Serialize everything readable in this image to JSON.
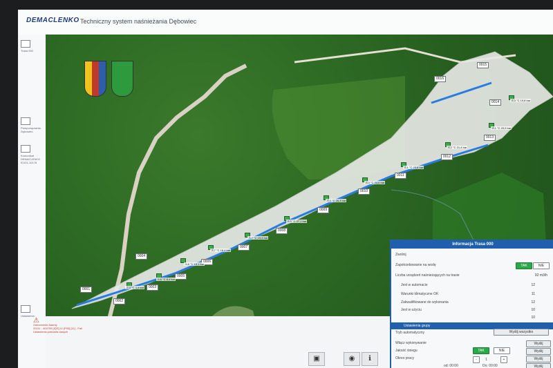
{
  "app": {
    "logo": "DEMACLENKO",
    "title": "Techniczny system  naśnieżania Dębowiec"
  },
  "sidebar": {
    "items": [
      {
        "label": "Trasa 000",
        "icon": "route-icon"
      },
      {
        "label": "Przepompownia Dębowiec",
        "icon": "pump-icon"
      },
      {
        "label": "Komunikat DEMACLENKO ID101-10178",
        "icon": "message-icon"
      },
      {
        "label": "Ustawienia",
        "icon": "wrench-icon"
      }
    ]
  },
  "alarm": {
    "title": "Ostrzeżenie Alarmy",
    "line1": "20111 - 404705 [IQS] 11 [P00] [11] - Fail",
    "line2": "Ustawienia pobrania danych"
  },
  "colors": {
    "accent": "#1f5fad",
    "green": "#2aa84a",
    "pipe": "#2a7be0"
  },
  "map": {
    "points": [
      {
        "id": "0001"
      },
      {
        "id": "0002"
      },
      {
        "id": "0003"
      },
      {
        "id": "0004"
      },
      {
        "id": "0005"
      },
      {
        "id": "0006"
      },
      {
        "id": "0007"
      },
      {
        "id": "0008"
      },
      {
        "id": "0009"
      },
      {
        "id": "0010"
      },
      {
        "id": "0011"
      },
      {
        "id": "0012"
      },
      {
        "id": "0013"
      },
      {
        "id": "0014"
      },
      {
        "id": "0015"
      },
      {
        "id": "0016"
      }
    ],
    "readings": [
      {
        "t": "-5,4 °C",
        "p": "4,9 bar"
      },
      {
        "t": "-5,6 °C",
        "p": "8,4 bar"
      },
      {
        "t": "-5,6 °C",
        "p": "15,1 bar"
      },
      {
        "t": "-5,7 °C",
        "p": "18,4 bar"
      },
      {
        "t": "-5,7 °C",
        "p": "19,4 bar"
      },
      {
        "t": "-5,9 °C",
        "p": "27,1 bar"
      },
      {
        "t": "-6,0 °C",
        "p": "26,3 bar"
      },
      {
        "t": "-6,0 °C",
        "p": "24,6 bar"
      },
      {
        "t": "-6,1 °C",
        "p": "23,8 bar"
      },
      {
        "t": "-6,2 °C",
        "p": "21,4 bar"
      },
      {
        "t": "-6,1 °C",
        "p": "20,9 bar"
      },
      {
        "t": "-6,3 °C",
        "p": "19,8 bar"
      }
    ]
  },
  "info": {
    "title": "Informacja Trasa 000",
    "zwolnij": "Zwolnij",
    "zapotrzebowanie": "Zapotrzebowanie na wodę",
    "tak": "TAK",
    "nie": "NIE",
    "liczba": "Liczba urządzeń naśnieżających na trasie",
    "flow": "92 m3/h",
    "rows": [
      {
        "label": "Jest w automacie",
        "value": "12"
      },
      {
        "label": "Warunki klimatyczne OK",
        "value": "11"
      },
      {
        "label": "Zakwalifikowane do wykonania",
        "value": "12"
      },
      {
        "label": "Jest w użyciu",
        "value": "10"
      },
      {
        "label": "",
        "value": "10"
      }
    ],
    "group_title": "Ustawienia grupy",
    "send_all": "Wyślij wszystko",
    "tryb": "Tryb automatyczny",
    "wlacz": "Włącz wykonywanie",
    "jakosc": "Jakość śniegu",
    "okres": "Okres pracy",
    "od": "od:",
    "do": "Do:",
    "time_from": "00:00",
    "time_to": "00:00",
    "qty": "1",
    "send": "Wyślij"
  }
}
